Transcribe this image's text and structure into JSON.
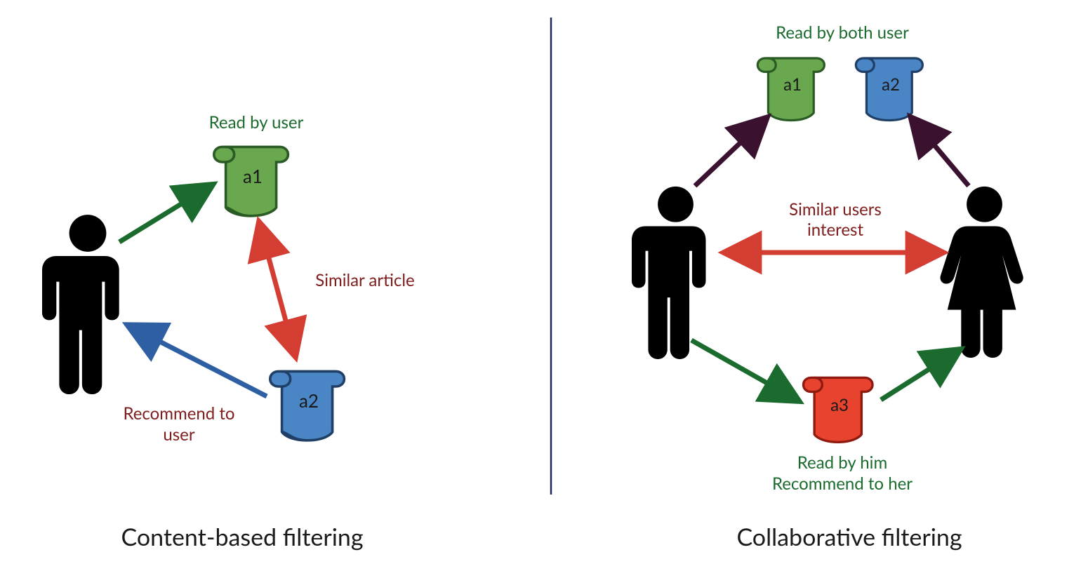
{
  "left": {
    "title": "Content-based filtering",
    "scroll_a1": {
      "label": "a1",
      "fill": "#6aa84f",
      "stroke": "#2b5b24"
    },
    "scroll_a2": {
      "label": "a2",
      "fill": "#4a86c5",
      "stroke": "#1f3f66"
    },
    "read_by_user": "Read by user",
    "similar_article": "Similar article",
    "recommend_to_user": "Recommend to\nuser"
  },
  "right": {
    "title": "Collaborative filtering",
    "scroll_a1": {
      "label": "a1",
      "fill": "#6aa84f",
      "stroke": "#2b5b24"
    },
    "scroll_a2": {
      "label": "a2",
      "fill": "#4a86c5",
      "stroke": "#1f3f66"
    },
    "scroll_a3": {
      "label": "a3",
      "fill": "#e8432e",
      "stroke": "#8e1a10"
    },
    "read_by_both": "Read by both user",
    "similar_users": "Similar users\ninterest",
    "read_recommend": "Read by him\nRecommend to her"
  },
  "colors": {
    "arrow_green": "#1b6b2e",
    "arrow_blue": "#2e5fa3",
    "arrow_red": "#d43d32",
    "arrow_dark": "#3a1230",
    "divider": "#1b2a5b"
  }
}
